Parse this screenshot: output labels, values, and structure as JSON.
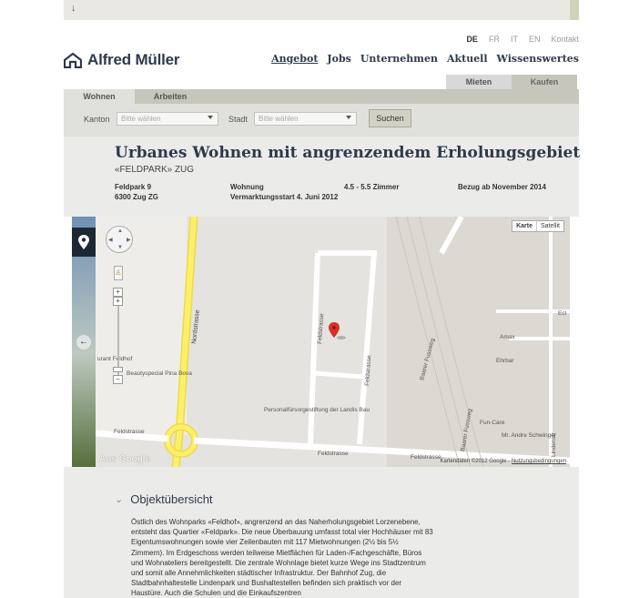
{
  "header": {
    "languages": [
      "DE",
      "FR",
      "IT",
      "EN"
    ],
    "active_language": "DE",
    "contact_label": "Kontakt",
    "logo_text": "Alfred Müller",
    "nav": [
      "Angebot",
      "Jobs",
      "Unternehmen",
      "Aktuell",
      "Wissenswertes"
    ]
  },
  "market_tabs": {
    "rent": "Mieten",
    "buy": "Kaufen"
  },
  "search": {
    "tabs": [
      "Wohnen",
      "Arbeiten"
    ],
    "canton_label": "Kanton",
    "canton_placeholder": "Bitte wählen",
    "city_label": "Stadt",
    "city_placeholder": "Bitte wählen",
    "submit_label": "Suchen"
  },
  "property": {
    "title": "Urbanes Wohnen mit angrenzendem Erholungsgebiet",
    "subtitle": "«FELDPARK» ZUG",
    "address_line1": "Feldpark 9",
    "address_line2": "6300 Zug ZG",
    "type": "Wohnung",
    "marketing_start": "Vermarktungsstart 4. Juni 2012",
    "rooms": "4.5 - 5.5 Zimmer",
    "move_in": "Bezug ab November 2014"
  },
  "map": {
    "type_map": "Karte",
    "type_satellite": "Satellit",
    "streets": [
      "Nordstrasse",
      "Feldstrasse",
      "Feldstrasse",
      "Feldstrasse",
      "Feldstrasse",
      "Feldstrasse",
      "Baarer Fussweg",
      "Baarer Fussweg"
    ],
    "poi_labels": [
      "Beautyspecial Pina Bova",
      "Personalfürsorgestiftung der Landis Bau",
      "Amax",
      "Ehrbar",
      "Fun-Care",
      "Mr. Andre Schwinger",
      "Lindenstr",
      "Ecl",
      "Aus",
      "urant Feldhof"
    ],
    "copyright": "Kartendaten ©2012 Google -",
    "terms": "Nutzungsbedingungen",
    "google": "Google"
  },
  "overview": {
    "heading": "Objektübersicht",
    "text": "Östlich des Wohnparks «Feldhof», angrenzend an das Naherholungsgebiet Lorzenebene, entsteht das Quartier «Feldpark». Die neue Überbauung umfasst total vier Hochhäuser mit 83 Eigentumswohnungen sowie vier Zeilenbauten mit 117 Mietwohnungen (2½ bis 5½ Zimmern). Im Erdgeschoss werden teilweise Mietflächen für Laden-/Fachgeschäfte, Büros und Wohnateliers bereitgestellt. Die zentrale Wohnlage bietet kurze Wege ins Stadtzentrum und somit alle Annehmlichkeiten städtischer Infrastruktur. Der Bahnhof Zug, die Stadtbahnhaltestelle Lindenpark und Bushaltestellen befinden sich praktisch vor der Haustüre. Auch die Schulen und die Einkaufszentren"
  }
}
